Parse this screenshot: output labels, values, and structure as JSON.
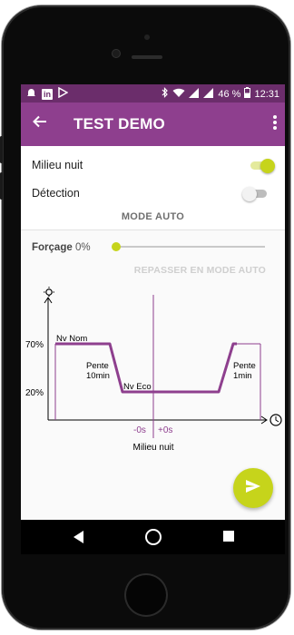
{
  "status_bar": {
    "battery_percent": "46 %",
    "time": "12:31",
    "left_icons": [
      "notification-icon",
      "linkedin-icon",
      "play-store-icon"
    ],
    "right_icons": [
      "bluetooth-icon",
      "wifi-icon",
      "signal-icon",
      "battery-icon"
    ]
  },
  "app_bar": {
    "title": "TEST DEMO",
    "back_icon": "arrow-back-icon",
    "menu_icon": "more-vert-icon"
  },
  "settings": {
    "milieu_nuit": {
      "label": "Milieu nuit",
      "checked": true
    },
    "detection": {
      "label": "Détection",
      "checked": false
    },
    "mode_label": "MODE AUTO"
  },
  "forcage": {
    "label": "Forçage",
    "value": "0%",
    "slider_fraction": 0,
    "repasser_label": "REPASSER EN MODE AUTO"
  },
  "diagram": {
    "y_label_high": "70%",
    "y_label_low": "20%",
    "nv_nom": "Nv Nom",
    "nv_eco": "Nv Eco",
    "pente_left": [
      "Pente",
      "10min"
    ],
    "pente_right": [
      "Pente",
      "1min"
    ],
    "minus_label": "-0s",
    "plus_label": "+0s",
    "milieu_label": "Milieu nuit",
    "y_axis_icon": "lightbulb-icon",
    "x_axis_icon": "clock-icon"
  },
  "fab": {
    "icon": "send-icon"
  },
  "colors": {
    "status_bar": "#6b2d6b",
    "app_bar": "#8e3f8e",
    "accent": "#c6d41b",
    "curve": "#8e3f8e"
  }
}
